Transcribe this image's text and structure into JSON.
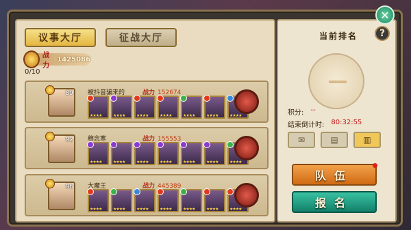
{
  "tabs": [
    {
      "label": "议事大厅"
    },
    {
      "label": "征战大厅"
    }
  ],
  "power": {
    "label": "战力",
    "value": "1425086"
  },
  "slots": "0/10",
  "players": [
    {
      "name": "被抖音骗来的",
      "level": "89",
      "power_label": "战力",
      "power": "152674",
      "heroes": [
        "fire",
        "poison",
        "fire",
        "fire",
        "grass",
        "fire",
        "water"
      ]
    },
    {
      "name": "穆念寒",
      "level": "92",
      "power_label": "战力",
      "power": "155553",
      "heroes": [
        "poison",
        "poison",
        "poison",
        "poison",
        "poison",
        "poison",
        "grass"
      ]
    },
    {
      "name": "大魔王",
      "level": "96",
      "power_label": "战力",
      "power": "445389",
      "heroes": [
        "fire",
        "grass",
        "water",
        "fire",
        "grass",
        "fire",
        "fire"
      ]
    }
  ],
  "ranking": {
    "title": "当前排名",
    "help": "?",
    "score_label": "积分:",
    "score_value": "--",
    "countdown_label": "结束倒计时:",
    "countdown_value": "80:32:55"
  },
  "buttons": {
    "team": "队伍",
    "signup": "报名"
  },
  "close_icon": "close-icon"
}
